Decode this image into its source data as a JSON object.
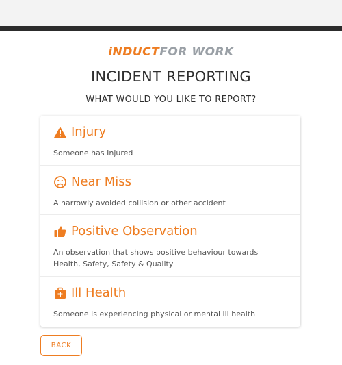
{
  "brand": {
    "logo_part1": "iNDUCT",
    "logo_part2": "FOR WORK",
    "accent": "#ee7d22",
    "logo_gray": "#9aa0a6"
  },
  "header": {
    "title": "INCIDENT REPORTING",
    "subtitle": "WHAT WOULD YOU LIKE TO REPORT?"
  },
  "options": [
    {
      "icon": "warning-icon",
      "title": "Injury",
      "description": "Someone has Injured"
    },
    {
      "icon": "frown-face-icon",
      "title": "Near Miss",
      "description": "A narrowly avoided collision or other accident"
    },
    {
      "icon": "thumbs-up-icon",
      "title": "Positive Observation",
      "description": "An observation that shows positive behaviour towards Health, Safety, Safety & Quality"
    },
    {
      "icon": "medical-bag-icon",
      "title": "Ill Health",
      "description": "Someone is experiencing physical or mental ill health"
    }
  ],
  "footer": {
    "back_label": "BACK"
  }
}
